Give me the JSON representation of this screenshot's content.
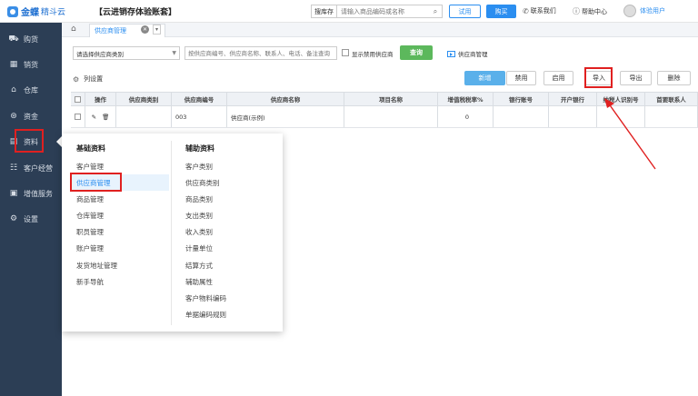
{
  "header": {
    "logo_text": "金蝶",
    "logo_sub": "精斗云",
    "app_title": "【云进销存体验账套】",
    "search_scope": "搜库存",
    "search_placeholder": "请输入商品编码或名称",
    "trial_label": "试用",
    "buy_label": "购买",
    "contact_label": "联系我们",
    "help_label": "帮助中心",
    "user_label": "体验用户"
  },
  "sidebar": {
    "items": [
      {
        "label": "购货",
        "icon": "cart-icon"
      },
      {
        "label": "销货",
        "icon": "sales-icon"
      },
      {
        "label": "仓库",
        "icon": "warehouse-icon"
      },
      {
        "label": "资金",
        "icon": "money-icon"
      },
      {
        "label": "资料",
        "icon": "document-icon"
      },
      {
        "label": "客户经营",
        "icon": "customer-icon"
      },
      {
        "label": "增值服务",
        "icon": "service-icon"
      },
      {
        "label": "设置",
        "icon": "gear-icon"
      }
    ]
  },
  "tabs": {
    "page_tab": "供应商管理"
  },
  "filters": {
    "category_select": "请选择供应商类别",
    "keyword_placeholder": "按供应商编号、供应商名称、联系人、电话、备注查询",
    "show_disabled_label": "显示禁用供应商",
    "query_label": "查询",
    "supplier_mgr_link": "供应商管理"
  },
  "toolbar": {
    "col_settings_label": "列设置",
    "add_label": "新增",
    "disable_label": "禁用",
    "enable_label": "启用",
    "import_label": "导入",
    "export_label": "导出",
    "delete_label": "删除"
  },
  "table": {
    "columns": [
      "操作",
      "供应商类别",
      "供应商编号",
      "供应商名称",
      "项目名称",
      "增值税税率%",
      "银行账号",
      "开户银行",
      "纳税人识别号",
      "首要联系人"
    ],
    "rows": [
      {
        "category": "",
        "code": "003",
        "name": "供应商(示例)",
        "project": "",
        "tax_rate": "0",
        "bank_account": "",
        "bank": "",
        "tax_id": "",
        "contact": ""
      }
    ]
  },
  "menu": {
    "basic_title": "基础资料",
    "basic_items": [
      "客户管理",
      "供应商管理",
      "商品管理",
      "仓库管理",
      "职员管理",
      "账户管理",
      "发货地址管理",
      "新手导航"
    ],
    "aux_title": "辅助资料",
    "aux_items": [
      "客户类别",
      "供应商类别",
      "商品类别",
      "支出类别",
      "收入类别",
      "计量单位",
      "结算方式",
      "辅助属性",
      "客户物料编码",
      "单据编码规则"
    ]
  },
  "colors": {
    "sidebar_bg": "#2c3e55",
    "accent": "#2b8ef0",
    "query_green": "#5cb85c",
    "annotation_red": "#e02020"
  }
}
